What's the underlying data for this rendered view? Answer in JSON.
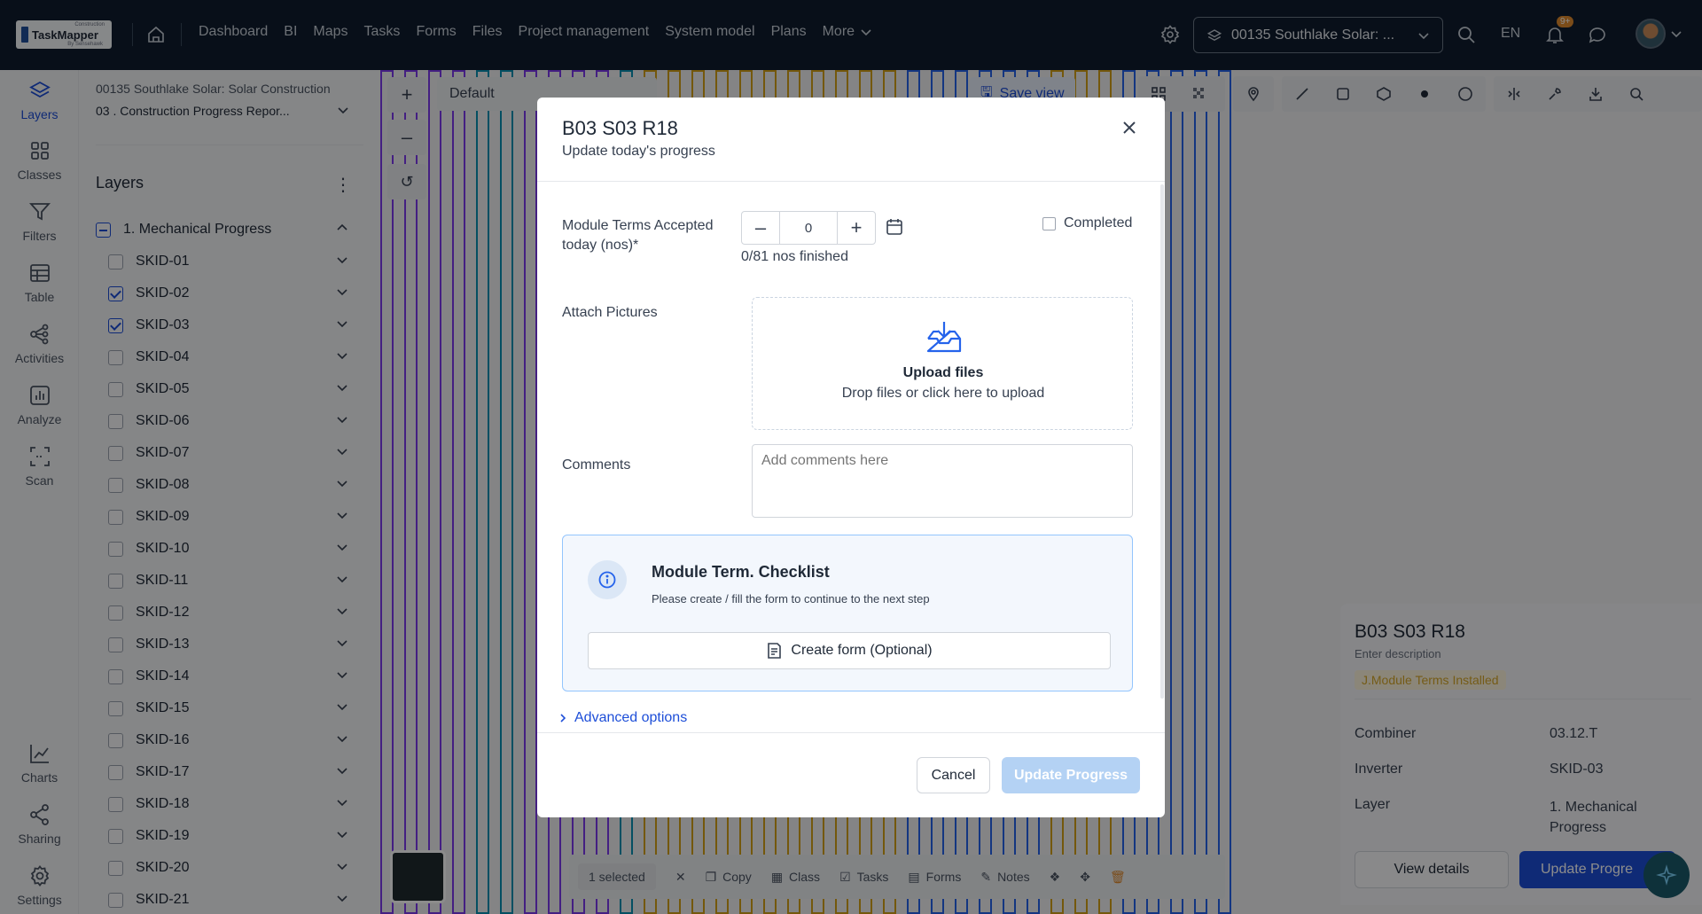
{
  "header": {
    "logo_text": "TaskMapper",
    "logo_super": "Construction",
    "logo_byline": "By Sensehawk",
    "nav": [
      "Dashboard",
      "BI",
      "Maps",
      "Tasks",
      "Forms",
      "Files",
      "Project management",
      "System model",
      "Plans"
    ],
    "more_label": "More",
    "project_select": "00135 Southlake Solar: ...",
    "language": "EN",
    "notification_badge": "9+"
  },
  "rail": {
    "items": [
      "Layers",
      "Classes",
      "Filters",
      "Table",
      "Activities",
      "Analyze",
      "Scan"
    ],
    "bottom_items": [
      "Charts",
      "Sharing",
      "Settings"
    ]
  },
  "panel": {
    "breadcrumb_project": "00135 Southlake Solar: Solar Construction",
    "breadcrumb_report": "03 . Construction Progress Repor...",
    "title": "Layers",
    "group_label": "1. Mechanical Progress",
    "skids": [
      {
        "label": "SKID-01",
        "checked": false
      },
      {
        "label": "SKID-02",
        "checked": true
      },
      {
        "label": "SKID-03",
        "checked": true
      },
      {
        "label": "SKID-04",
        "checked": false
      },
      {
        "label": "SKID-05",
        "checked": false
      },
      {
        "label": "SKID-06",
        "checked": false
      },
      {
        "label": "SKID-07",
        "checked": false
      },
      {
        "label": "SKID-08",
        "checked": false
      },
      {
        "label": "SKID-09",
        "checked": false
      },
      {
        "label": "SKID-10",
        "checked": false
      },
      {
        "label": "SKID-11",
        "checked": false
      },
      {
        "label": "SKID-12",
        "checked": false
      },
      {
        "label": "SKID-13",
        "checked": false
      },
      {
        "label": "SKID-14",
        "checked": false
      },
      {
        "label": "SKID-15",
        "checked": false
      },
      {
        "label": "SKID-16",
        "checked": false
      },
      {
        "label": "SKID-17",
        "checked": false
      },
      {
        "label": "SKID-18",
        "checked": false
      },
      {
        "label": "SKID-19",
        "checked": false
      },
      {
        "label": "SKID-20",
        "checked": false
      },
      {
        "label": "SKID-21",
        "checked": false
      }
    ]
  },
  "map": {
    "view_select": "Default",
    "save_view": "Save view",
    "bottom_bar": {
      "selected": "1 selected",
      "copy": "Copy",
      "class": "Class",
      "tasks": "Tasks",
      "forms": "Forms",
      "notes": "Notes"
    },
    "stripe_colors": [
      "#7c3aed",
      "#0891b2",
      "#d4a017",
      "#2563eb"
    ]
  },
  "info_card": {
    "title": "B03 S03 R18",
    "description": "Enter description",
    "tag": "J.Module Terms Installed",
    "rows": [
      {
        "key": "Combiner",
        "value": "03.12.T"
      },
      {
        "key": "Inverter",
        "value": "SKID-03"
      },
      {
        "key": "Layer",
        "value": "1. Mechanical Progress"
      }
    ],
    "view_details": "View details",
    "update_progress": "Update Progre"
  },
  "modal": {
    "title": "B03 S03 R18",
    "subtitle": "Update today's progress",
    "field_label": "Module Terms Accepted today (nos)*",
    "stepper_value": "0",
    "finished_text": "0/81 nos finished",
    "completed_label": "Completed",
    "attach_label": "Attach Pictures",
    "upload_title": "Upload files",
    "upload_sub": "Drop files or click here to upload",
    "comments_label": "Comments",
    "comments_placeholder": "Add comments here",
    "checklist_title": "Module Term. Checklist",
    "checklist_sub": "Please create / fill the form to continue to the next step",
    "create_form": "Create form (Optional)",
    "advanced": "Advanced options",
    "cancel": "Cancel",
    "update": "Update Progress"
  }
}
